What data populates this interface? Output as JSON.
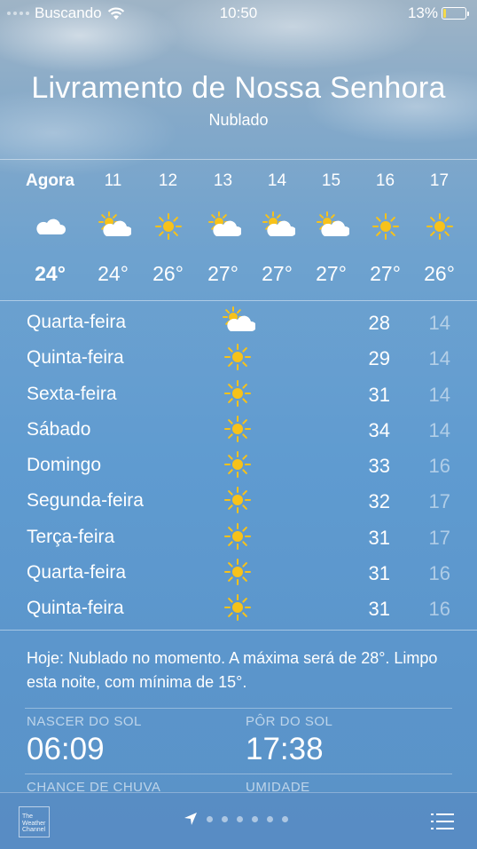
{
  "status": {
    "carrier": "Buscando",
    "time": "10:50",
    "battery": "13%",
    "battery_level": 0.13
  },
  "location": {
    "city": "Livramento de Nossa Senhora",
    "condition": "Nublado"
  },
  "hourly": [
    {
      "label": "Agora",
      "temp": "24°",
      "icon": "cloud-icon"
    },
    {
      "label": "11",
      "temp": "24°",
      "icon": "partly-cloudy-icon"
    },
    {
      "label": "12",
      "temp": "26°",
      "icon": "sun-icon"
    },
    {
      "label": "13",
      "temp": "27°",
      "icon": "partly-cloudy-icon"
    },
    {
      "label": "14",
      "temp": "27°",
      "icon": "partly-cloudy-icon"
    },
    {
      "label": "15",
      "temp": "27°",
      "icon": "partly-cloudy-icon"
    },
    {
      "label": "16",
      "temp": "27°",
      "icon": "sun-icon"
    },
    {
      "label": "17",
      "temp": "26°",
      "icon": "sun-icon"
    }
  ],
  "daily": [
    {
      "day": "Quarta-feira",
      "icon": "partly-cloudy-icon",
      "high": "28",
      "low": "14"
    },
    {
      "day": "Quinta-feira",
      "icon": "sun-icon",
      "high": "29",
      "low": "14"
    },
    {
      "day": "Sexta-feira",
      "icon": "sun-icon",
      "high": "31",
      "low": "14"
    },
    {
      "day": "Sábado",
      "icon": "sun-icon",
      "high": "34",
      "low": "14"
    },
    {
      "day": "Domingo",
      "icon": "sun-icon",
      "high": "33",
      "low": "16"
    },
    {
      "day": "Segunda-feira",
      "icon": "sun-icon",
      "high": "32",
      "low": "17"
    },
    {
      "day": "Terça-feira",
      "icon": "sun-icon",
      "high": "31",
      "low": "17"
    },
    {
      "day": "Quarta-feira",
      "icon": "sun-icon",
      "high": "31",
      "low": "16"
    },
    {
      "day": "Quinta-feira",
      "icon": "sun-icon",
      "high": "31",
      "low": "16"
    }
  ],
  "summary": "Hoje: Nublado no momento. A máxima será de 28°. Limpo esta noite, com mínima de 15°.",
  "details": {
    "sunrise_label": "NASCER DO SOL",
    "sunrise": "06:09",
    "sunset_label": "PÔR DO SOL",
    "sunset": "17:38",
    "rain_label": "CHANCE DE CHUVA",
    "humidity_label": "UMIDADE"
  },
  "footer": {
    "brand": "The Weather Channel",
    "page_count": 6
  },
  "colors": {
    "sun": "#f7c21a",
    "cloud": "#ffffff",
    "battery": "#f4d94a"
  }
}
